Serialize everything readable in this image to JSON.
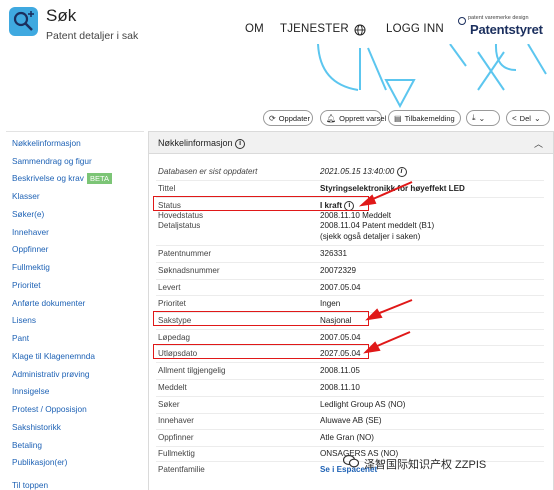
{
  "header": {
    "app_title": "Søk",
    "app_subtitle": "Patent detaljer i sak",
    "nav": [
      "OM",
      "TJENESTER",
      "LOGG INN"
    ],
    "brand_tagline": "patent varemerke design",
    "brand_name": "Patentstyret"
  },
  "toolbar": {
    "update": "Oppdater",
    "alert": "Opprett varsel",
    "feedback": "Tilbakemelding",
    "download": "",
    "share": "Del"
  },
  "sidebar": {
    "items": [
      "Nøkkelinformasjon",
      "Sammendrag og figur",
      "Beskrivelse og krav",
      "Klasser",
      "Søker(e)",
      "Innehaver",
      "Oppfinner",
      "Fullmektig",
      "Prioritet",
      "Anførte dokumenter",
      "Lisens",
      "Pant",
      "Klage til Klagenemnda",
      "Administrativ prøving",
      "Innsigelse",
      "Protest / Opposisjon",
      "Sakshistorikk",
      "Betaling",
      "Publikasjon(er)",
      "Til toppen"
    ],
    "beta_label": "BETA"
  },
  "panel": {
    "title": "Nøkkelinformasjon",
    "rows": [
      {
        "label": "Databasen er sist oppdatert",
        "value": "2021.05.15 13:40:00"
      },
      {
        "label": "Tittel",
        "value": "Styringselektronikk for høyeffekt LED"
      },
      {
        "label": "Status",
        "value": "I kraft"
      },
      {
        "label": "Hovedstatus",
        "value": "2008.11.10 Meddelt"
      },
      {
        "label": "Detaljstatus",
        "value": "2008.11.04 Patent meddelt (B1)"
      },
      {
        "label": "",
        "value": "(sjekk også detaljer i saken)"
      },
      {
        "label": "Patentnummer",
        "value": "326331"
      },
      {
        "label": "Søknadsnummer",
        "value": "20072329"
      },
      {
        "label": "Levert",
        "value": "2007.05.04"
      },
      {
        "label": "Prioritet",
        "value": "Ingen"
      },
      {
        "label": "Sakstype",
        "value": "Nasjonal"
      },
      {
        "label": "Løpedag",
        "value": "2007.05.04"
      },
      {
        "label": "Utløpsdato",
        "value": "2027.05.04"
      },
      {
        "label": "Allment tilgjengelig",
        "value": "2008.11.05"
      },
      {
        "label": "Meddelt",
        "value": "2008.11.10"
      },
      {
        "label": "Søker",
        "value": "Ledlight Group AS (NO)"
      },
      {
        "label": "Innehaver",
        "value": "Aluwave AB (SE)"
      },
      {
        "label": "Oppfinner",
        "value": "Atle Gran (NO)"
      },
      {
        "label": "Fullmektig",
        "value": "ONSAGERS AS (NO)"
      },
      {
        "label": "Patentfamilie",
        "value": "Se i Espacenet"
      }
    ]
  },
  "watermark": "泽智国际知识产权 ZZPIS",
  "colors": {
    "link": "#1e62b5",
    "annotation": "#e01818",
    "brand": "#1b2f5e",
    "deco": "#5cc6ef"
  }
}
